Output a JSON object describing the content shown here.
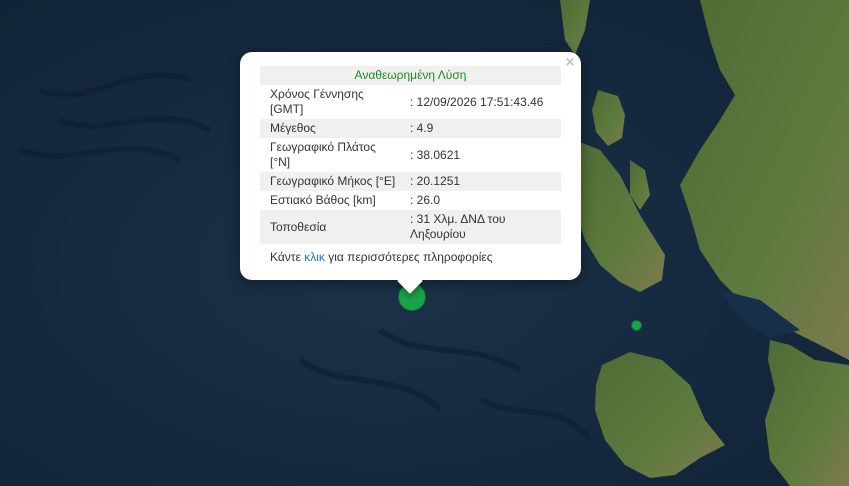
{
  "popup": {
    "title": "Αναθεωρημένη Λύση",
    "close_label": "×",
    "rows": [
      {
        "label": "Χρόνος Γέννησης [GMT]",
        "value": ": 12/09/2026 17:51:43.46"
      },
      {
        "label": "Μέγεθος",
        "value": ": 4.9"
      },
      {
        "label": "Γεωγραφικό Πλάτος [°N]",
        "value": ": 38.0621"
      },
      {
        "label": "Γεωγραφικό Μήκος [°E]",
        "value": ": 20.1251"
      },
      {
        "label": "Εστιακό Βάθος [km]",
        "value": ": 26.0"
      },
      {
        "label": "Τοποθεσία",
        "value": ": 31 Χλμ. ΔΝΔ του Ληξουρίου"
      }
    ],
    "more_prefix": "Κάντε ",
    "more_link": "κλικ",
    "more_suffix": " για περισσότερες πληροφορίες"
  },
  "colors": {
    "marker": "#1aa44a",
    "title": "#1d8a1d",
    "link": "#1976c8"
  }
}
